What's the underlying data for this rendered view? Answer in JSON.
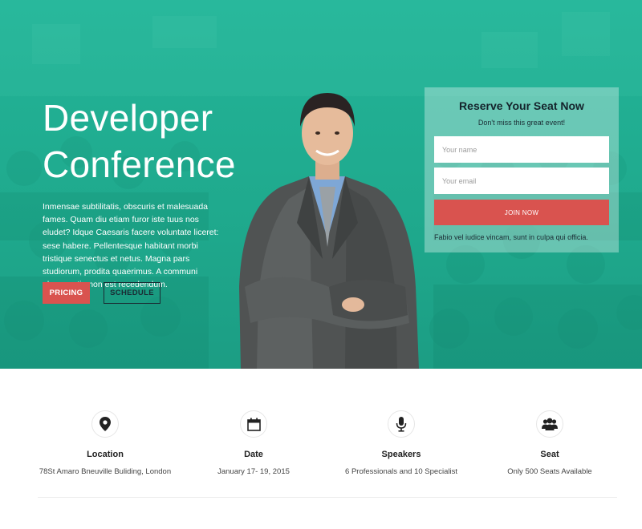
{
  "hero": {
    "title_line1": "Developer",
    "title_line2": "Conference",
    "intro": "Inmensae subtilitatis, obscuris et malesuada fames. Quam diu etiam furor iste tuus nos eludet? Idque Caesaris facere voluntate liceret: sese habere. Pellentesque habitant morbi tristique senectus et netus. Magna pars studiorum, prodita quaerimus. A communi observantia non est recedendum.",
    "pricing_label": "PRICING",
    "schedule_label": "SCHEDULE"
  },
  "reserve": {
    "title": "Reserve Your Seat Now",
    "subtitle": "Don't miss this great event!",
    "name_placeholder": "Your name",
    "email_placeholder": "Your email",
    "join_label": "JOIN NOW",
    "note": "Fabio vel iudice vincam, sunt in culpa qui officia."
  },
  "features": [
    {
      "icon": "map-marker-icon",
      "title": "Location",
      "desc": "78St Amaro Bneuville Buliding, London"
    },
    {
      "icon": "calendar-icon",
      "title": "Date",
      "desc": "January 17- 19, 2015"
    },
    {
      "icon": "microphone-icon",
      "title": "Speakers",
      "desc": "6 Professionals and 10 Specialist"
    },
    {
      "icon": "users-icon",
      "title": "Seat",
      "desc": "Only 500 Seats Available"
    }
  ],
  "colors": {
    "accent": "#d9534f",
    "hero_teal": "#1fae94",
    "dark": "#1a2b33"
  }
}
